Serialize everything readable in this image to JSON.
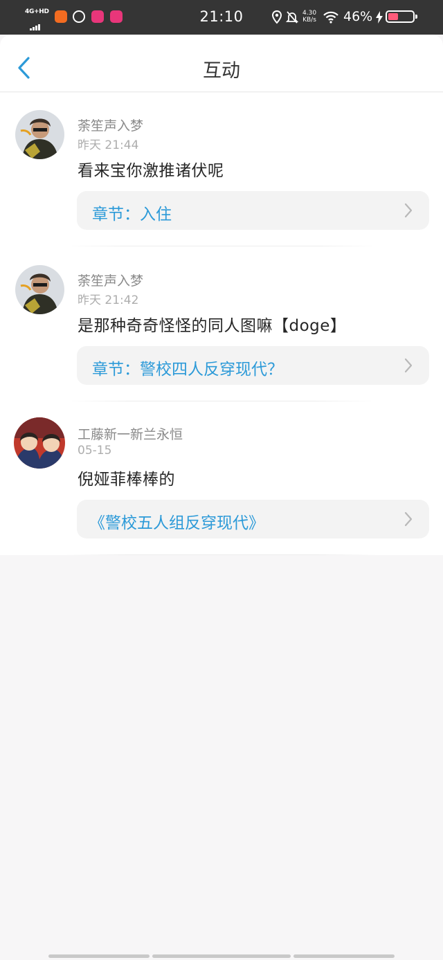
{
  "status_bar": {
    "network": "4G+HD",
    "time": "21:10",
    "speed_value": "4.30",
    "speed_unit": "KB/s",
    "battery_percent": "46%"
  },
  "header": {
    "title": "互动"
  },
  "comments": [
    {
      "user": "荼笙声入梦",
      "time": "昨天 21:44",
      "text": "看来宝你激推诸伏呢",
      "source": "章节：入住"
    },
    {
      "user": "荼笙声入梦",
      "time": "昨天 21:42",
      "text": "是那种奇奇怪怪的同人图嘛【doge】",
      "source": "章节：警校四人反穿现代？"
    },
    {
      "user": "工藤新一新兰永恒",
      "time": "05-15",
      "text": "倪娅菲棒棒的",
      "source": "《警校五人组反穿现代》"
    }
  ],
  "colors": {
    "accent": "#2c9ad8",
    "status_bar_bg": "#353535"
  }
}
